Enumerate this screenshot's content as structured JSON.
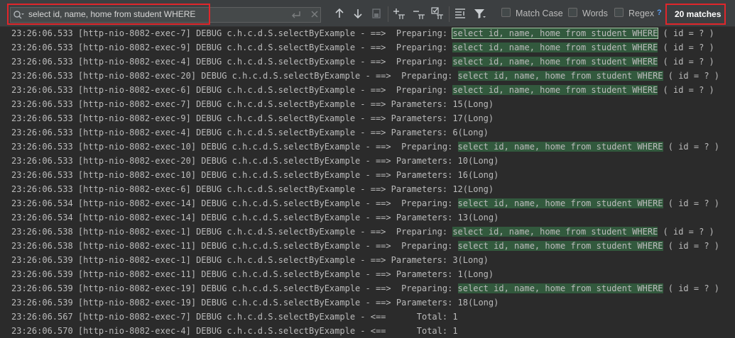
{
  "search": {
    "query": "select id, name, home from student WHERE",
    "match_case_label": "Match Case",
    "words_label": "Words",
    "regex_label": "Regex",
    "help": "?",
    "matches": "20 matches"
  },
  "log": [
    {
      "pre": "23:26:06.533 [http-nio-8082-exec-7] DEBUG c.h.c.d.S.selectByExample - ==>  Preparing: ",
      "match": "select id, name, home from student WHERE",
      "post": " ( id = ? )"
    },
    {
      "pre": "23:26:06.533 [http-nio-8082-exec-9] DEBUG c.h.c.d.S.selectByExample - ==>  Preparing: ",
      "match": "select id, name, home from student WHERE",
      "post": " ( id = ? )"
    },
    {
      "pre": "23:26:06.533 [http-nio-8082-exec-4] DEBUG c.h.c.d.S.selectByExample - ==>  Preparing: ",
      "match": "select id, name, home from student WHERE",
      "post": " ( id = ? )"
    },
    {
      "pre": "23:26:06.533 [http-nio-8082-exec-20] DEBUG c.h.c.d.S.selectByExample - ==>  Preparing: ",
      "match": "select id, name, home from student WHERE",
      "post": " ( id = ? )"
    },
    {
      "pre": "23:26:06.533 [http-nio-8082-exec-6] DEBUG c.h.c.d.S.selectByExample - ==>  Preparing: ",
      "match": "select id, name, home from student WHERE",
      "post": " ( id = ? )"
    },
    {
      "pre": "23:26:06.533 [http-nio-8082-exec-7] DEBUG c.h.c.d.S.selectByExample - ==> Parameters: 15(Long)"
    },
    {
      "pre": "23:26:06.533 [http-nio-8082-exec-9] DEBUG c.h.c.d.S.selectByExample - ==> Parameters: 17(Long)"
    },
    {
      "pre": "23:26:06.533 [http-nio-8082-exec-4] DEBUG c.h.c.d.S.selectByExample - ==> Parameters: 6(Long)"
    },
    {
      "pre": "23:26:06.533 [http-nio-8082-exec-10] DEBUG c.h.c.d.S.selectByExample - ==>  Preparing: ",
      "match": "select id, name, home from student WHERE",
      "post": " ( id = ? )"
    },
    {
      "pre": "23:26:06.533 [http-nio-8082-exec-20] DEBUG c.h.c.d.S.selectByExample - ==> Parameters: 10(Long)"
    },
    {
      "pre": "23:26:06.533 [http-nio-8082-exec-10] DEBUG c.h.c.d.S.selectByExample - ==> Parameters: 16(Long)"
    },
    {
      "pre": "23:26:06.533 [http-nio-8082-exec-6] DEBUG c.h.c.d.S.selectByExample - ==> Parameters: 12(Long)"
    },
    {
      "pre": "23:26:06.534 [http-nio-8082-exec-14] DEBUG c.h.c.d.S.selectByExample - ==>  Preparing: ",
      "match": "select id, name, home from student WHERE",
      "post": " ( id = ? )"
    },
    {
      "pre": "23:26:06.534 [http-nio-8082-exec-14] DEBUG c.h.c.d.S.selectByExample - ==> Parameters: 13(Long)"
    },
    {
      "pre": "23:26:06.538 [http-nio-8082-exec-1] DEBUG c.h.c.d.S.selectByExample - ==>  Preparing: ",
      "match": "select id, name, home from student WHERE",
      "post": " ( id = ? )"
    },
    {
      "pre": "23:26:06.538 [http-nio-8082-exec-11] DEBUG c.h.c.d.S.selectByExample - ==>  Preparing: ",
      "match": "select id, name, home from student WHERE",
      "post": " ( id = ? )"
    },
    {
      "pre": "23:26:06.539 [http-nio-8082-exec-1] DEBUG c.h.c.d.S.selectByExample - ==> Parameters: 3(Long)"
    },
    {
      "pre": "23:26:06.539 [http-nio-8082-exec-11] DEBUG c.h.c.d.S.selectByExample - ==> Parameters: 1(Long)"
    },
    {
      "pre": "23:26:06.539 [http-nio-8082-exec-19] DEBUG c.h.c.d.S.selectByExample - ==>  Preparing: ",
      "match": "select id, name, home from student WHERE",
      "post": " ( id = ? )"
    },
    {
      "pre": "23:26:06.539 [http-nio-8082-exec-19] DEBUG c.h.c.d.S.selectByExample - ==> Parameters: 18(Long)"
    },
    {
      "pre": "23:26:06.567 [http-nio-8082-exec-7] DEBUG c.h.c.d.S.selectByExample - <==      Total: 1"
    },
    {
      "pre": "23:26:06.570 [http-nio-8082-exec-4] DEBUG c.h.c.d.S.selectByExample - <==      Total: 1"
    }
  ]
}
